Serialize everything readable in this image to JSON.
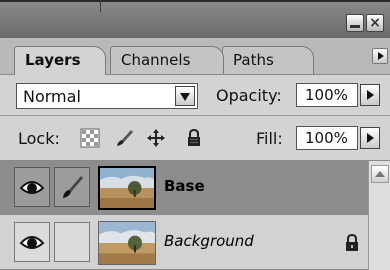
{
  "tabs": [
    {
      "label": "Layers",
      "active": true
    },
    {
      "label": "Channels",
      "active": false
    },
    {
      "label": "Paths",
      "active": false
    }
  ],
  "blend_mode": {
    "value": "Normal"
  },
  "opacity": {
    "label": "Opacity:",
    "value": "100%"
  },
  "lock": {
    "label": "Lock:",
    "icons": [
      "lock-transparent-pixels-icon",
      "lock-image-pixels-icon",
      "lock-position-icon",
      "lock-all-icon"
    ]
  },
  "fill": {
    "label": "Fill:",
    "value": "100%"
  },
  "layers": [
    {
      "name": "Base",
      "selected": true,
      "visible": true,
      "brush": true,
      "locked": false
    },
    {
      "name": "Background",
      "selected": false,
      "visible": true,
      "brush": false,
      "locked": true
    }
  ],
  "colors": {
    "selected_row": "#8c8c8c",
    "panel_bg": "#d3d3d3",
    "title_bar": "#7a7a7a"
  }
}
